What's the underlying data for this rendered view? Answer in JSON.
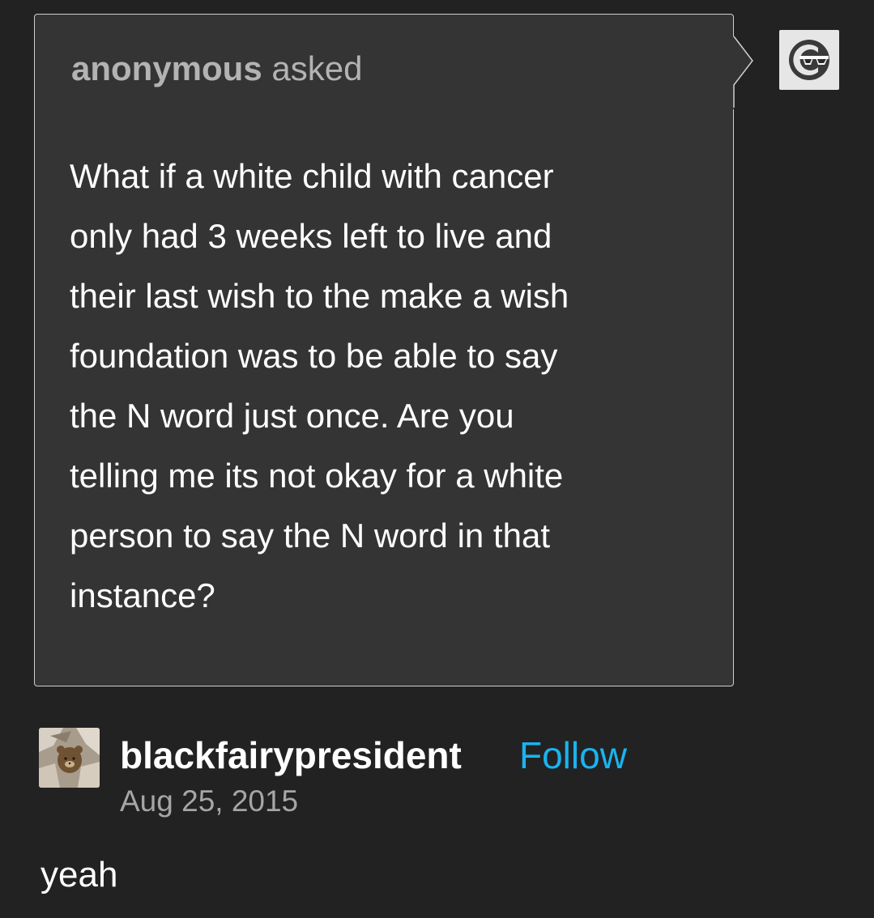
{
  "ask": {
    "asker": "anonymous",
    "action": "asked",
    "question_lines": [
      "What if a white child with cancer",
      "only had 3 weeks left to live and",
      "their last wish to the make a wish",
      "foundation was to be able to say",
      "the N word just once. Are you",
      "telling me its not okay for a white",
      "person to say the N word in that",
      "instance?"
    ],
    "avatar_icon": "anonymous-sunglasses-icon"
  },
  "answer": {
    "username": "blackfairypresident",
    "follow_label": "Follow",
    "date": "Aug 25, 2015",
    "text": "yeah",
    "avatar_icon": "user-avatar-photo"
  },
  "colors": {
    "background": "#222222",
    "ask_box": "#343434",
    "ask_border": "#cfcfcf",
    "follow": "#1ab3f0",
    "muted_text": "#a6a6a6"
  }
}
